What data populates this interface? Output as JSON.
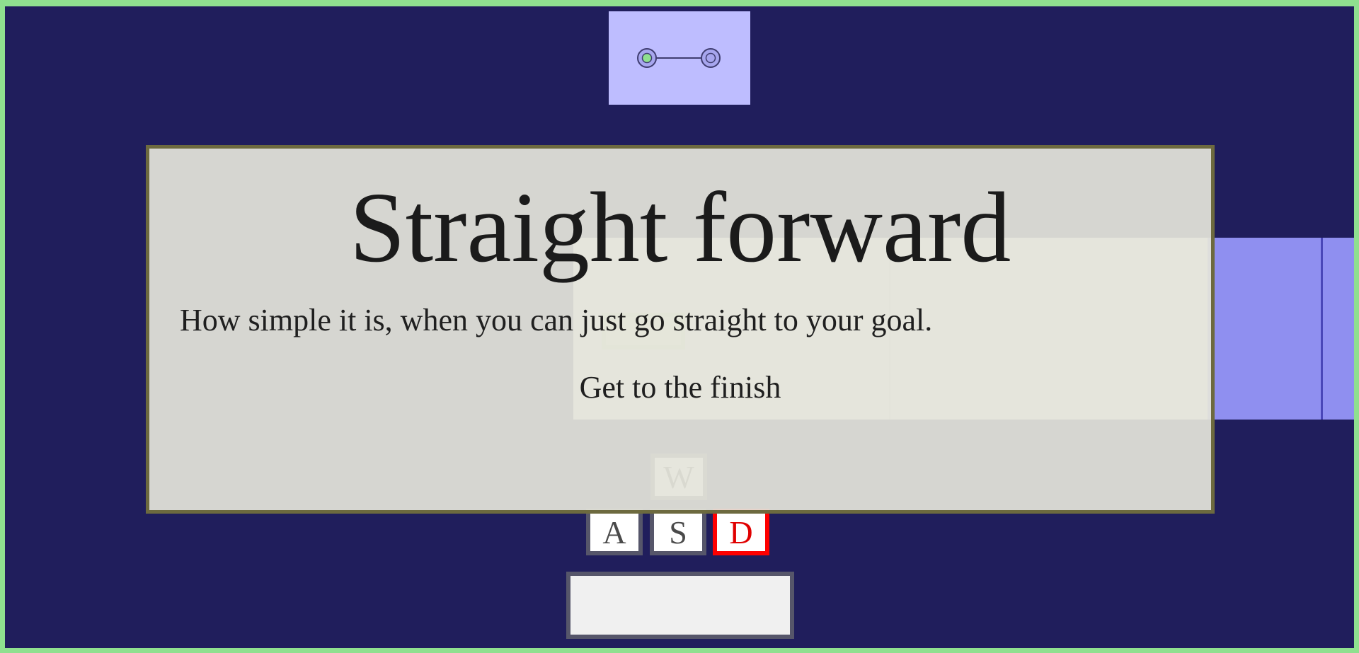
{
  "level": {
    "title": "Straight forward",
    "description": "How simple it is, when you can just go straight to your goal.",
    "instruction": "Get to the finish"
  },
  "progress": {
    "current_level": 1,
    "total_levels": 2
  },
  "controls": {
    "keys": [
      {
        "id": "w",
        "label": "W",
        "pressed": false
      },
      {
        "id": "a",
        "label": "A",
        "pressed": false
      },
      {
        "id": "s",
        "label": "S",
        "pressed": false
      },
      {
        "id": "d",
        "label": "D",
        "pressed": true
      }
    ],
    "status_text": ""
  },
  "colors": {
    "background": "#201e5c",
    "border": "#8fe08f",
    "goal": "#8f8ff0",
    "player": "#ecf7d6",
    "map_panel": "#bebdff",
    "active_key": "#ff0000"
  }
}
